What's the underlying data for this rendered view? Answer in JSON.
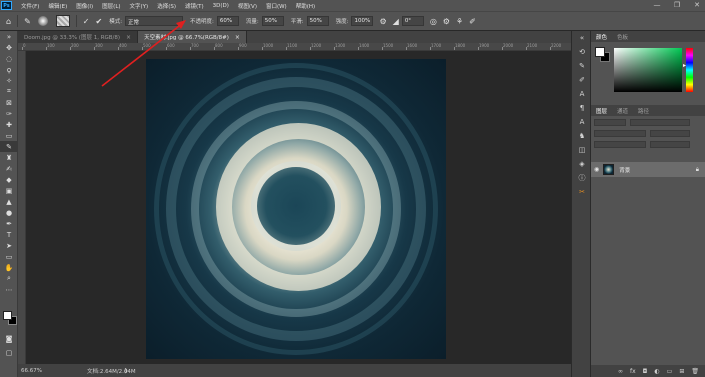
{
  "menu": {
    "logo": "Ps",
    "items": [
      "文件(F)",
      "编辑(E)",
      "图像(I)",
      "图层(L)",
      "文字(Y)",
      "选择(S)",
      "滤镜(T)",
      "3D(D)",
      "视图(V)",
      "窗口(W)",
      "帮助(H)"
    ]
  },
  "window_controls": [
    "—",
    "❐",
    "✕"
  ],
  "options": {
    "mode_label": "模式:",
    "mode_value": "正常",
    "opacity_label": "不透明度:",
    "opacity_value": "60%",
    "flow_label": "流量:",
    "flow_value": "50%",
    "smooth_label": "平滑:",
    "smooth_value": "50%",
    "strength_label": "强度:",
    "strength_value": "100%",
    "angle_value": "0°"
  },
  "tabs": [
    {
      "label": "Doom.jpg @ 33.3% (图层 1, RGB/8)",
      "active": false
    },
    {
      "label": "天空素材.jpg @ 66.7%(RGB/8#)",
      "active": true
    }
  ],
  "ruler_numbers": [
    "0",
    "100",
    "200",
    "300",
    "400",
    "500",
    "600",
    "700",
    "800",
    "900",
    "1000",
    "1100",
    "1200",
    "1300",
    "1400",
    "1500",
    "1600",
    "1700",
    "1800",
    "1900",
    "2000",
    "2100",
    "2200"
  ],
  "status": {
    "zoom": "66.67%",
    "doc": "文档:2.64M/2.64M"
  },
  "color_panel": {
    "tabs": [
      "颜色",
      "色板"
    ]
  },
  "layers_panel": {
    "tabs": [
      "图层",
      "通道",
      "路径"
    ],
    "layer_name": "背景"
  },
  "colors": {
    "accent": "#31a8ff",
    "arrow": "#e02020"
  }
}
